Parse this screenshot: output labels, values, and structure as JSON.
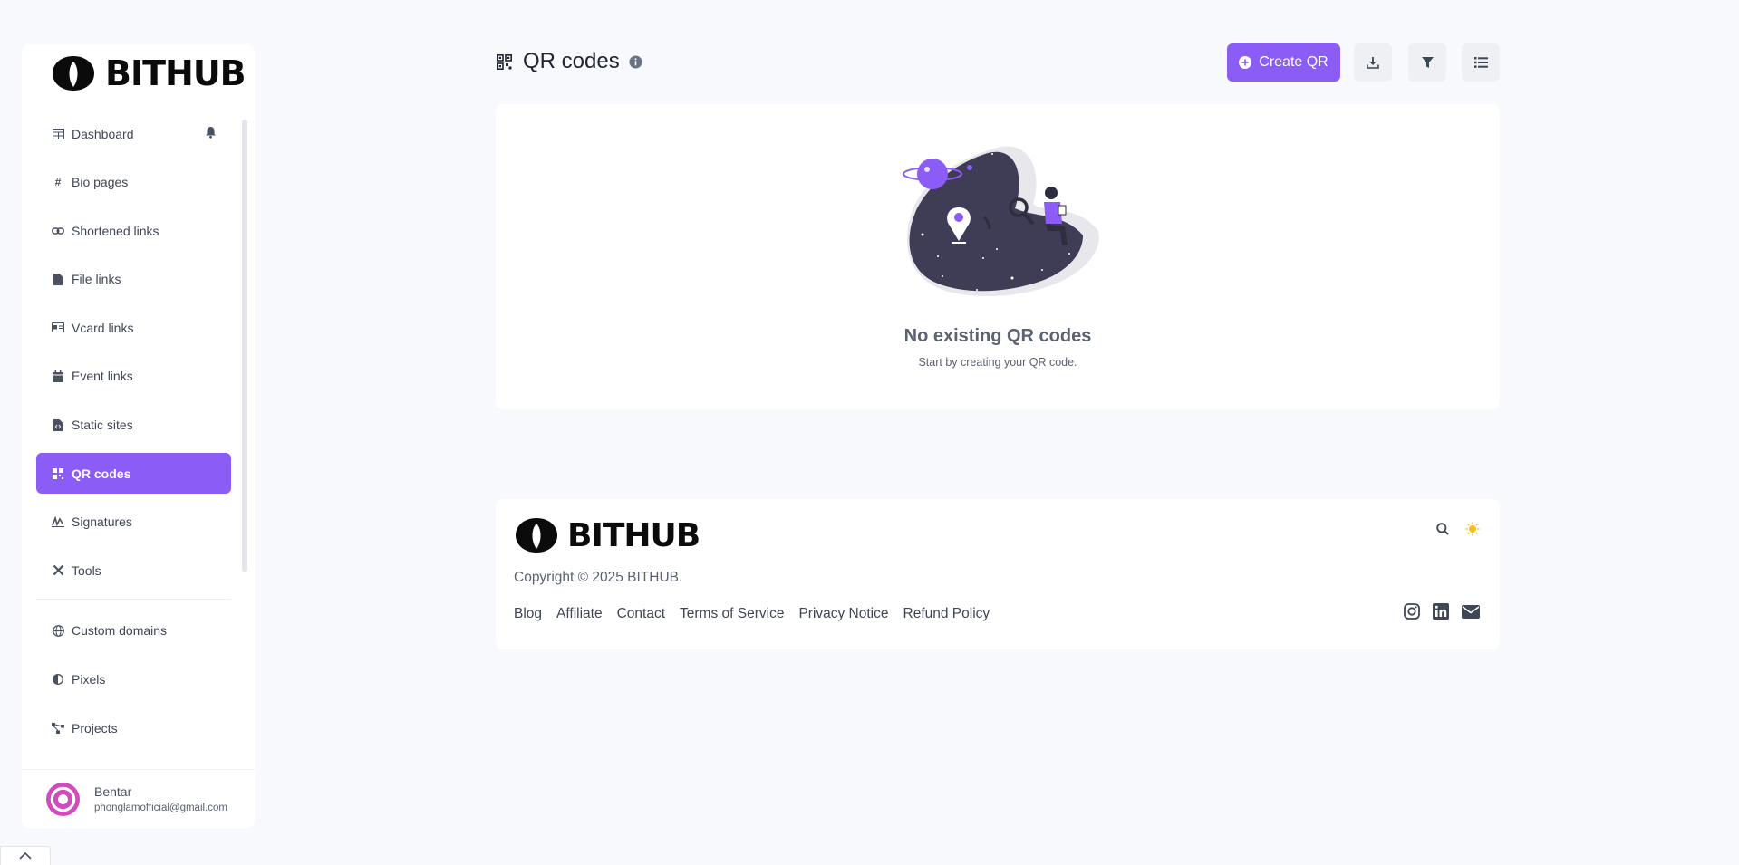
{
  "brand": {
    "name": "BITHUB",
    "accent": "#8b5cf6"
  },
  "sidebar": {
    "items": [
      {
        "label": "Dashboard",
        "icon": "table-icon"
      },
      {
        "label": "Bio pages",
        "icon": "hash-icon"
      },
      {
        "label": "Shortened links",
        "icon": "link-icon"
      },
      {
        "label": "File links",
        "icon": "file-icon"
      },
      {
        "label": "Vcard links",
        "icon": "id-card-icon"
      },
      {
        "label": "Event links",
        "icon": "calendar-icon"
      },
      {
        "label": "Static sites",
        "icon": "file-code-icon"
      },
      {
        "label": "QR codes",
        "icon": "qrcode-icon",
        "active": true
      },
      {
        "label": "Signatures",
        "icon": "signature-icon"
      },
      {
        "label": "Tools",
        "icon": "tools-icon"
      },
      {
        "label": "Custom domains",
        "icon": "globe-icon"
      },
      {
        "label": "Pixels",
        "icon": "adjust-icon"
      },
      {
        "label": "Projects",
        "icon": "project-diagram-icon"
      }
    ],
    "user": {
      "name": "Bentar",
      "email": "phonglamofficial@gmail.com"
    }
  },
  "header": {
    "title": "QR codes",
    "create_label": "Create QR"
  },
  "empty_state": {
    "title": "No existing QR codes",
    "subtitle": "Start by creating your QR code."
  },
  "footer": {
    "copyright": "Copyright © 2025 BITHUB.",
    "links": [
      "Blog",
      "Affiliate",
      "Contact",
      "Terms of Service",
      "Privacy Notice",
      "Refund Policy"
    ]
  }
}
